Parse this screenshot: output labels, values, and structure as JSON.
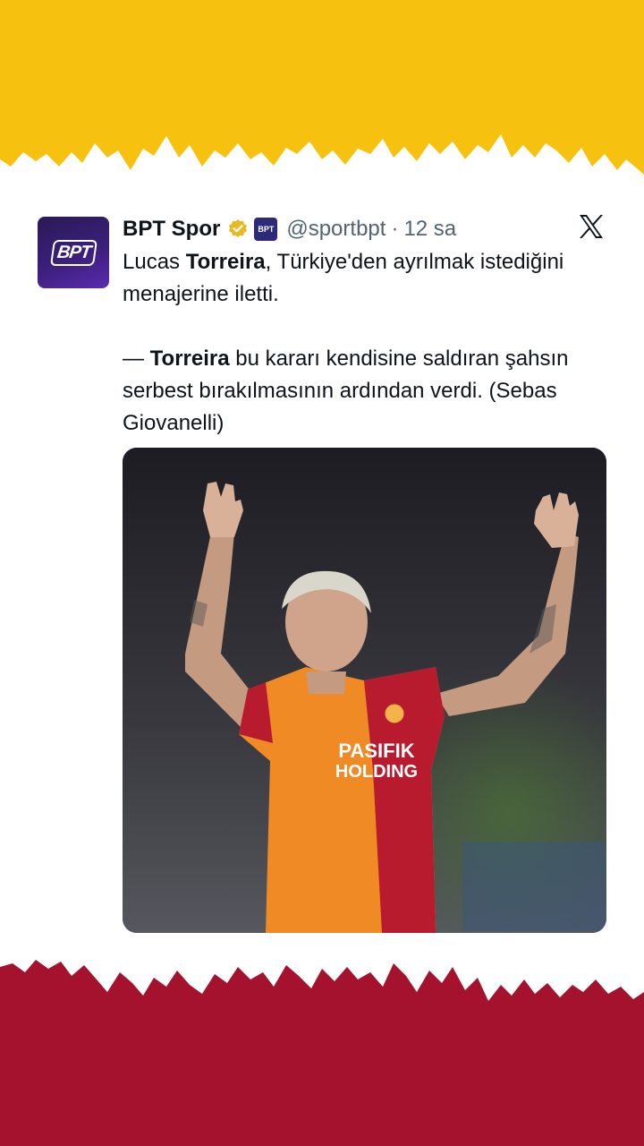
{
  "tweet": {
    "display_name": "BPT Spor",
    "avatar_text": "BPT",
    "affiliate_badge": "BPT",
    "handle": "@sportbpt",
    "separator": "·",
    "time": "12 sa",
    "line1": {
      "pre": "Lucas ",
      "bold": "Torreira",
      "post": ", Türkiye'den ayrılmak istediğini menajerine iletti."
    },
    "line2": {
      "pre": "— ",
      "bold": "Torreira",
      "post": " bu kararı kendisine saldıran şahsın serbest bırakılmasının ardından verdi. (Sebas Giovanelli)"
    },
    "jersey": {
      "sponsor1": "PASIFIK",
      "sponsor2": "HOLDING"
    }
  },
  "icons": {
    "verified": "verified-check-icon",
    "platform": "x-logo-icon"
  },
  "colors": {
    "top_band": "#f7c20f",
    "bottom_band": "#a5122d",
    "verified": "#e8b923",
    "text": "#0f1419",
    "muted": "#536471"
  }
}
